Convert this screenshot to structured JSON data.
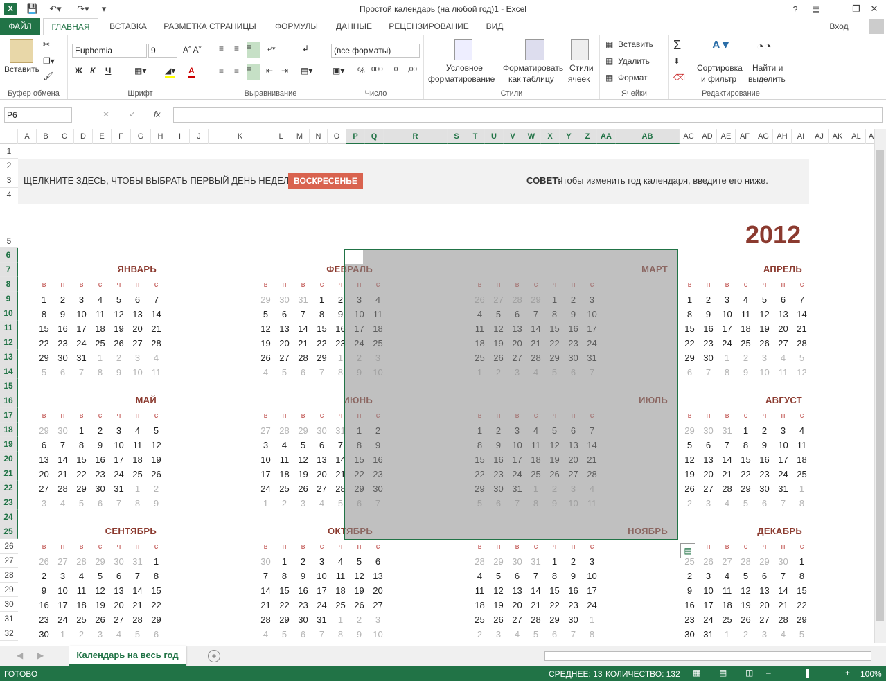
{
  "title": "Простой календарь (на любой год)1 - Excel",
  "colors": {
    "accent": "#217346",
    "month": "#8b3a2f",
    "dayhead": "#c0504d",
    "button": "#d9634f"
  },
  "tabs": {
    "file": "ФАЙЛ",
    "home": "ГЛАВНАЯ",
    "insert": "ВСТАВКА",
    "layout": "РАЗМЕТКА СТРАНИЦЫ",
    "formulas": "ФОРМУЛЫ",
    "data": "ДАННЫЕ",
    "review": "РЕЦЕНЗИРОВАНИЕ",
    "view": "ВИД",
    "signin": "Вход"
  },
  "ribbon": {
    "paste": "Вставить",
    "clipboard": "Буфер обмена",
    "font_name": "Euphemia",
    "font_size": "9",
    "font": "Шрифт",
    "bold": "Ж",
    "italic": "К",
    "underline": "Ч",
    "align": "Выравнивание",
    "num_format": "(все форматы)",
    "number": "Число",
    "cond1": "Условное",
    "cond2": "форматирование",
    "fmt1": "Форматировать",
    "fmt2": "как таблицу",
    "styles1": "Стили",
    "styles2": "ячеек",
    "styles": "Стили",
    "insert": "Вставить",
    "delete": "Удалить",
    "format": "Формат",
    "cells": "Ячейки",
    "sort1": "Сортировка",
    "sort2": "и фильтр",
    "find1": "Найти и",
    "find2": "выделить",
    "editing": "Редактирование"
  },
  "namebox": "P6",
  "fx": "fx",
  "columns": [
    "A",
    "B",
    "C",
    "D",
    "E",
    "F",
    "G",
    "H",
    "I",
    "J",
    "K",
    "L",
    "M",
    "N",
    "O",
    "P",
    "Q",
    "R",
    "S",
    "T",
    "U",
    "V",
    "W",
    "X",
    "Y",
    "Z",
    "AA",
    "AB",
    "AC",
    "AD",
    "AE",
    "AF",
    "AG",
    "AH",
    "AI",
    "AJ",
    "AK",
    "AL",
    "A"
  ],
  "rows": [
    "1",
    "2",
    "3",
    "4",
    "5",
    "6",
    "7",
    "8",
    "9",
    "10",
    "11",
    "12",
    "13",
    "14",
    "15",
    "16",
    "17",
    "18",
    "19",
    "20",
    "21",
    "22",
    "23",
    "24",
    "25",
    "26",
    "27",
    "28",
    "29",
    "30",
    "31",
    "32"
  ],
  "banner": {
    "prompt": "ЩЕЛКНИТЕ ЗДЕСЬ, ЧТОБЫ ВЫБРАТЬ ПЕРВЫЙ ДЕНЬ НЕДЕЛИ:",
    "button": "ВОСКРЕСЕНЬЕ",
    "tip_bold": "СОВЕТ:",
    "tip": " Чтобы изменить год календаря, введите его ниже."
  },
  "year": "2012",
  "weekdays": [
    "в",
    "п",
    "в",
    "с",
    "ч",
    "п",
    "с"
  ],
  "months": [
    {
      "name": "ЯНВАРЬ",
      "days": [
        "1",
        "2",
        "3",
        "4",
        "5",
        "6",
        "7",
        "8",
        "9",
        "10",
        "11",
        "12",
        "13",
        "14",
        "15",
        "16",
        "17",
        "18",
        "19",
        "20",
        "21",
        "22",
        "23",
        "24",
        "25",
        "26",
        "27",
        "28",
        "29",
        "30",
        "31",
        "1",
        "2",
        "3",
        "4",
        "5",
        "6",
        "7",
        "8",
        "9",
        "10",
        "11"
      ],
      "prev": 0,
      "count": 31
    },
    {
      "name": "ФЕВРАЛЬ",
      "days": [
        "29",
        "30",
        "31",
        "1",
        "2",
        "3",
        "4",
        "5",
        "6",
        "7",
        "8",
        "9",
        "10",
        "11",
        "12",
        "13",
        "14",
        "15",
        "16",
        "17",
        "18",
        "19",
        "20",
        "21",
        "22",
        "23",
        "24",
        "25",
        "26",
        "27",
        "28",
        "29",
        "1",
        "2",
        "3",
        "4",
        "5",
        "6",
        "7",
        "8",
        "9",
        "10"
      ],
      "prev": 3,
      "count": 29
    },
    {
      "name": "МАРТ",
      "days": [
        "26",
        "27",
        "28",
        "29",
        "1",
        "2",
        "3",
        "4",
        "5",
        "6",
        "7",
        "8",
        "9",
        "10",
        "11",
        "12",
        "13",
        "14",
        "15",
        "16",
        "17",
        "18",
        "19",
        "20",
        "21",
        "22",
        "23",
        "24",
        "25",
        "26",
        "27",
        "28",
        "29",
        "30",
        "31",
        "1",
        "2",
        "3",
        "4",
        "5",
        "6",
        "7"
      ],
      "prev": 4,
      "count": 31
    },
    {
      "name": "АПРЕЛЬ",
      "days": [
        "1",
        "2",
        "3",
        "4",
        "5",
        "6",
        "7",
        "8",
        "9",
        "10",
        "11",
        "12",
        "13",
        "14",
        "15",
        "16",
        "17",
        "18",
        "19",
        "20",
        "21",
        "22",
        "23",
        "24",
        "25",
        "26",
        "27",
        "28",
        "29",
        "30",
        "1",
        "2",
        "3",
        "4",
        "5",
        "6",
        "7",
        "8",
        "9",
        "10",
        "11",
        "12"
      ],
      "prev": 0,
      "count": 30
    },
    {
      "name": "МАЙ",
      "days": [
        "29",
        "30",
        "1",
        "2",
        "3",
        "4",
        "5",
        "6",
        "7",
        "8",
        "9",
        "10",
        "11",
        "12",
        "13",
        "14",
        "15",
        "16",
        "17",
        "18",
        "19",
        "20",
        "21",
        "22",
        "23",
        "24",
        "25",
        "26",
        "27",
        "28",
        "29",
        "30",
        "31",
        "1",
        "2",
        "3",
        "4",
        "5",
        "6",
        "7",
        "8",
        "9"
      ],
      "prev": 2,
      "count": 31
    },
    {
      "name": "ИЮНЬ",
      "days": [
        "27",
        "28",
        "29",
        "30",
        "31",
        "1",
        "2",
        "3",
        "4",
        "5",
        "6",
        "7",
        "8",
        "9",
        "10",
        "11",
        "12",
        "13",
        "14",
        "15",
        "16",
        "17",
        "18",
        "19",
        "20",
        "21",
        "22",
        "23",
        "24",
        "25",
        "26",
        "27",
        "28",
        "29",
        "30",
        "1",
        "2",
        "3",
        "4",
        "5",
        "6",
        "7"
      ],
      "prev": 5,
      "count": 30
    },
    {
      "name": "ИЮЛЬ",
      "days": [
        "1",
        "2",
        "3",
        "4",
        "5",
        "6",
        "7",
        "8",
        "9",
        "10",
        "11",
        "12",
        "13",
        "14",
        "15",
        "16",
        "17",
        "18",
        "19",
        "20",
        "21",
        "22",
        "23",
        "24",
        "25",
        "26",
        "27",
        "28",
        "29",
        "30",
        "31",
        "1",
        "2",
        "3",
        "4",
        "5",
        "6",
        "7",
        "8",
        "9",
        "10",
        "11"
      ],
      "prev": 0,
      "count": 31
    },
    {
      "name": "АВГУСТ",
      "days": [
        "29",
        "30",
        "31",
        "1",
        "2",
        "3",
        "4",
        "5",
        "6",
        "7",
        "8",
        "9",
        "10",
        "11",
        "12",
        "13",
        "14",
        "15",
        "16",
        "17",
        "18",
        "19",
        "20",
        "21",
        "22",
        "23",
        "24",
        "25",
        "26",
        "27",
        "28",
        "29",
        "30",
        "31",
        "1",
        "2",
        "3",
        "4",
        "5",
        "6",
        "7",
        "8"
      ],
      "prev": 3,
      "count": 31
    },
    {
      "name": "СЕНТЯБРЬ",
      "days": [
        "26",
        "27",
        "28",
        "29",
        "30",
        "31",
        "1",
        "2",
        "3",
        "4",
        "5",
        "6",
        "7",
        "8",
        "9",
        "10",
        "11",
        "12",
        "13",
        "14",
        "15",
        "16",
        "17",
        "18",
        "19",
        "20",
        "21",
        "22",
        "23",
        "24",
        "25",
        "26",
        "27",
        "28",
        "29",
        "30",
        "1",
        "2",
        "3",
        "4",
        "5",
        "6"
      ],
      "prev": 6,
      "count": 30
    },
    {
      "name": "ОКТЯБРЬ",
      "days": [
        "30",
        "1",
        "2",
        "3",
        "4",
        "5",
        "6",
        "7",
        "8",
        "9",
        "10",
        "11",
        "12",
        "13",
        "14",
        "15",
        "16",
        "17",
        "18",
        "19",
        "20",
        "21",
        "22",
        "23",
        "24",
        "25",
        "26",
        "27",
        "28",
        "29",
        "30",
        "31",
        "1",
        "2",
        "3",
        "4",
        "5",
        "6",
        "7",
        "8",
        "9",
        "10"
      ],
      "prev": 1,
      "count": 31
    },
    {
      "name": "НОЯБРЬ",
      "days": [
        "28",
        "29",
        "30",
        "31",
        "1",
        "2",
        "3",
        "4",
        "5",
        "6",
        "7",
        "8",
        "9",
        "10",
        "11",
        "12",
        "13",
        "14",
        "15",
        "16",
        "17",
        "18",
        "19",
        "20",
        "21",
        "22",
        "23",
        "24",
        "25",
        "26",
        "27",
        "28",
        "29",
        "30",
        "1",
        "2",
        "3",
        "4",
        "5",
        "6",
        "7",
        "8"
      ],
      "prev": 4,
      "count": 30
    },
    {
      "name": "ДЕКАБРЬ",
      "days": [
        "25",
        "26",
        "27",
        "28",
        "29",
        "30",
        "1",
        "2",
        "3",
        "4",
        "5",
        "6",
        "7",
        "8",
        "9",
        "10",
        "11",
        "12",
        "13",
        "14",
        "15",
        "16",
        "17",
        "18",
        "19",
        "20",
        "21",
        "22",
        "23",
        "24",
        "25",
        "26",
        "27",
        "28",
        "29",
        "30",
        "31",
        "1",
        "2",
        "3",
        "4",
        "5"
      ],
      "prev": 6,
      "count": 31
    }
  ],
  "sheet": "Календарь на весь год",
  "status": {
    "ready": "ГОТОВО",
    "avg": "СРЕДНЕЕ: 13",
    "count": "КОЛИЧЕСТВО: 132",
    "zoom": "100%"
  }
}
